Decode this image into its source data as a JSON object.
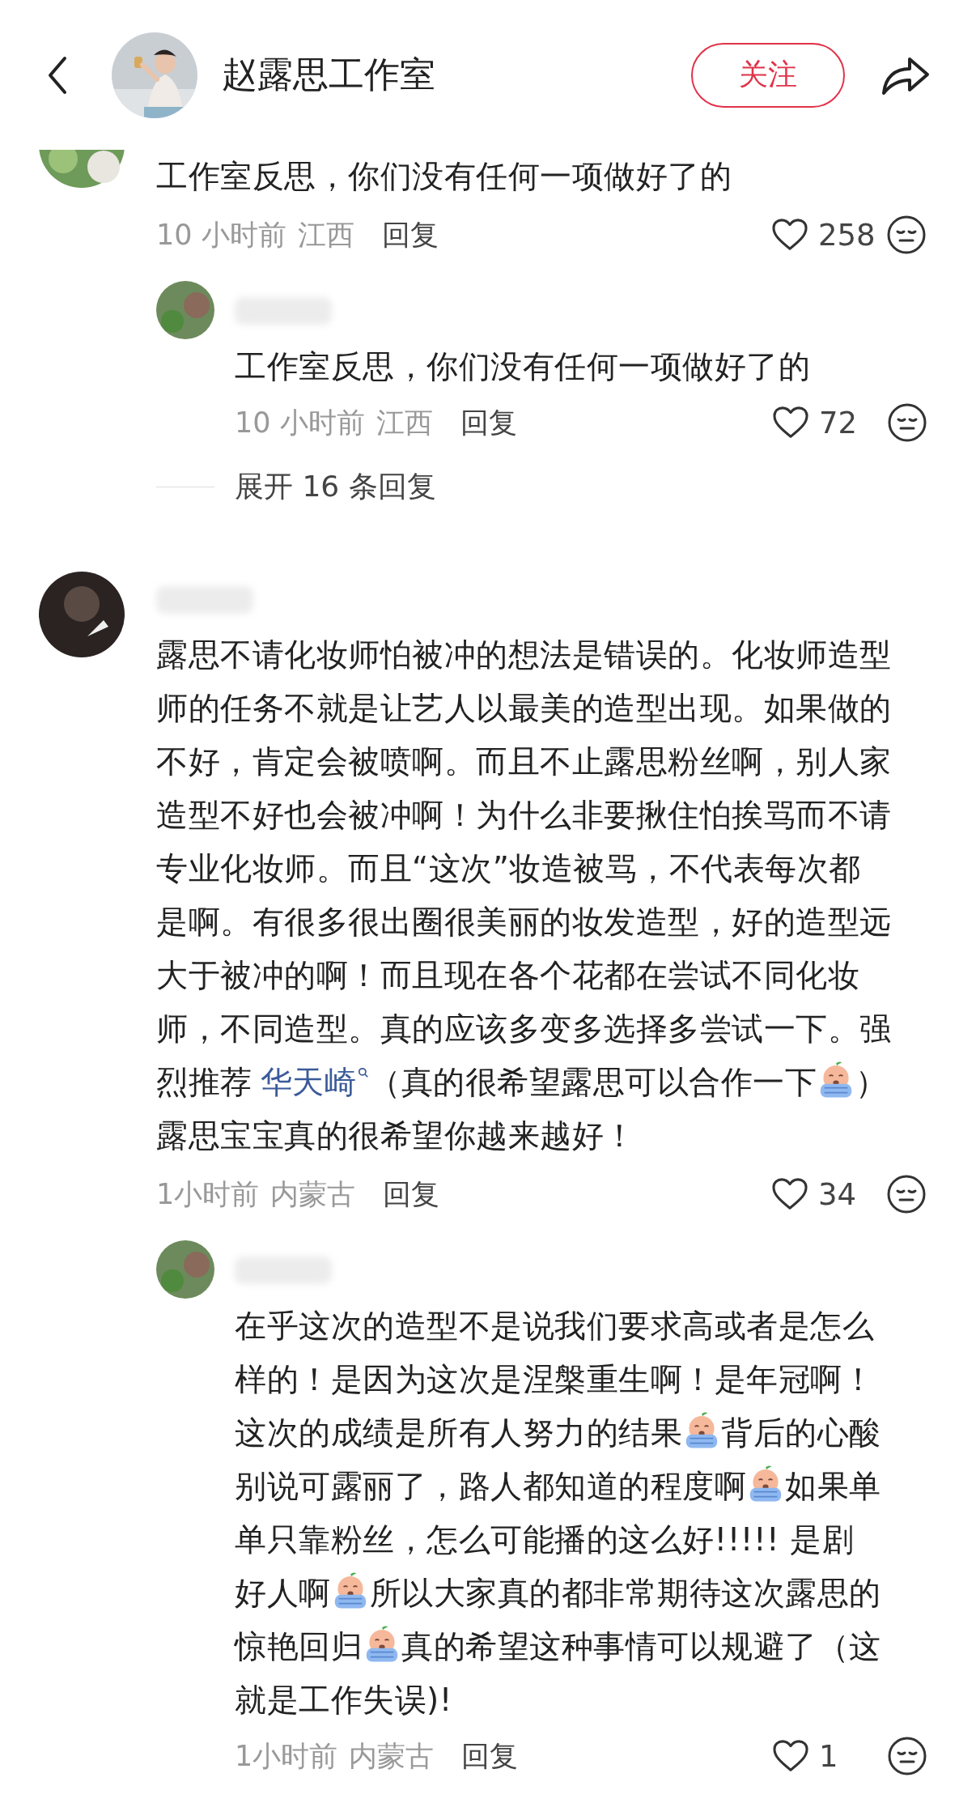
{
  "header": {
    "title": "赵露思工作室",
    "follow_button": "关注"
  },
  "comments": [
    {
      "cut_off_top": true,
      "lines": [
        [
          {
            "kind": "text",
            "text": "工作室反思，你们没有任何一项做好了的"
          }
        ]
      ],
      "time": "10 小时前",
      "location": "江西",
      "reply_button": "回复",
      "likes": "258",
      "replies": [
        {
          "lines": [
            [
              {
                "kind": "text",
                "text": "工作室反思，你们没有任何一项做好了的"
              }
            ]
          ],
          "time": "10 小时前",
          "location": "江西",
          "reply_button": "回复",
          "likes": "72"
        }
      ],
      "expand": "展开 16 条回复"
    },
    {
      "cut_off_top": false,
      "lines": [
        [
          {
            "kind": "text",
            "text": "露思不请化妆师怕被冲的想法是错误的。化妆师造型"
          }
        ],
        [
          {
            "kind": "text",
            "text": "师的任务不就是让艺人以最美的造型出现。如果做的"
          }
        ],
        [
          {
            "kind": "text",
            "text": "不好，肯定会被喷啊。而且不止露思粉丝啊，别人家"
          }
        ],
        [
          {
            "kind": "text",
            "text": "造型不好也会被冲啊！为什么非要揪住怕挨骂而不请"
          }
        ],
        [
          {
            "kind": "text",
            "text": "专业化妆师。而且“这次”妆造被骂，不代表每次都"
          }
        ],
        [
          {
            "kind": "text",
            "text": "是啊。有很多很出圈很美丽的妆发造型，好的造型远"
          }
        ],
        [
          {
            "kind": "text",
            "text": "大于被冲的啊！而且现在各个花都在尝试不同化妆"
          }
        ],
        [
          {
            "kind": "text",
            "text": "师，不同造型。真的应该多变多选择多尝试一下。强"
          }
        ],
        [
          {
            "kind": "text",
            "text": "烈推荐"
          },
          {
            "kind": "mention",
            "text": "华天崎"
          },
          {
            "kind": "text",
            "text": "（真的很希望露思可以合作一下"
          },
          {
            "kind": "emoji"
          },
          {
            "kind": "text",
            "text": "）"
          }
        ],
        [
          {
            "kind": "text",
            "text": "露思宝宝真的很希望你越来越好！"
          }
        ]
      ],
      "time": "1小时前",
      "location": "内蒙古",
      "reply_button": "回复",
      "likes": "34",
      "replies": [
        {
          "lines": [
            [
              {
                "kind": "text",
                "text": "在乎这次的造型不是说我们要求高或者是怎么"
              }
            ],
            [
              {
                "kind": "text",
                "text": "样的！是因为这次是涅槃重生啊！是年冠啊！"
              }
            ],
            [
              {
                "kind": "text",
                "text": "这次的成绩是所有人努力的结果"
              },
              {
                "kind": "emoji"
              },
              {
                "kind": "text",
                "text": "背后的心酸"
              }
            ],
            [
              {
                "kind": "text",
                "text": "别说可露丽了，路人都知道的程度啊"
              },
              {
                "kind": "emoji"
              },
              {
                "kind": "text",
                "text": "如果单"
              }
            ],
            [
              {
                "kind": "text",
                "text": "单只靠粉丝，怎么可能播的这么好!!!!! 是剧"
              }
            ],
            [
              {
                "kind": "text",
                "text": "好人啊"
              },
              {
                "kind": "emoji"
              },
              {
                "kind": "text",
                "text": "所以大家真的都非常期待这次露思的"
              }
            ],
            [
              {
                "kind": "text",
                "text": "惊艳回归"
              },
              {
                "kind": "emoji"
              },
              {
                "kind": "text",
                "text": "真的希望这种事情可以规避了（这"
              }
            ],
            [
              {
                "kind": "text",
                "text": "就是工作失误)!"
              }
            ]
          ],
          "time": "1小时前",
          "location": "内蒙古",
          "reply_button": "回复",
          "likes": "1"
        }
      ]
    }
  ]
}
